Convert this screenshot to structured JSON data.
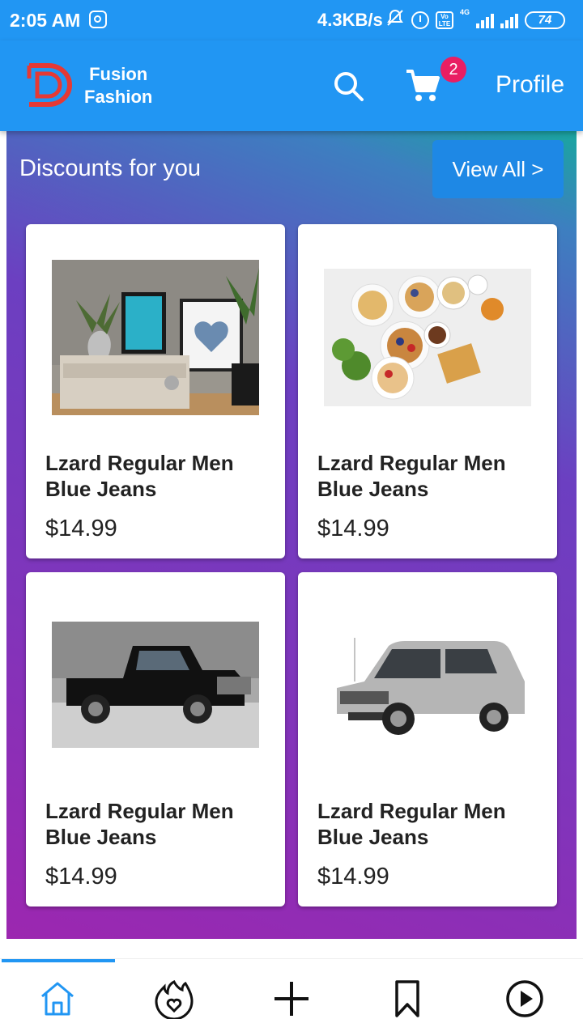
{
  "status_bar": {
    "time": "2:05 AM",
    "speed": "4.3KB/s",
    "volte": "Vo LTE",
    "network": "4G",
    "battery": "74",
    "icons": [
      "instagram-icon",
      "bell-off-icon",
      "alarm-icon",
      "volte-icon",
      "signal-icon",
      "battery-icon"
    ]
  },
  "app_bar": {
    "brand_line1": "Fusion",
    "brand_line2": "Fashion",
    "cart_count": "2",
    "profile_label": "Profile",
    "brand_color": "#2196F3",
    "badge_color": "#E91E63"
  },
  "section": {
    "title": "Discounts for you",
    "view_all_label": "View All >"
  },
  "products": [
    {
      "name": "Lzard Regular Men Blue Jeans",
      "price": "$14.99",
      "image": "living-room-shelf-image"
    },
    {
      "name": "Lzard Regular Men Blue Jeans",
      "price": "$14.99",
      "image": "breakfast-table-image"
    },
    {
      "name": "Lzard Regular Men Blue Jeans",
      "price": "$14.99",
      "image": "black-pickup-truck-image"
    },
    {
      "name": "Lzard Regular Men Blue Jeans",
      "price": "$14.99",
      "image": "silver-minivan-image"
    }
  ],
  "bottom_nav": {
    "items": [
      "home-icon",
      "trending-fire-icon",
      "add-icon",
      "bookmark-icon",
      "play-icon"
    ],
    "active": "home-icon",
    "active_color": "#2196F3"
  }
}
